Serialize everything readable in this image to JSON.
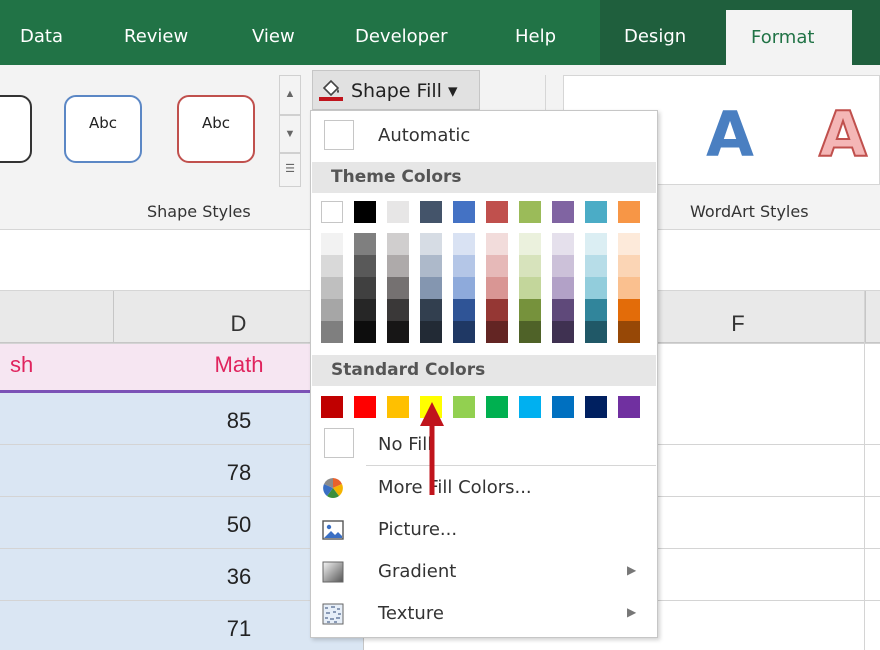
{
  "ribbon": {
    "tabs": [
      {
        "label": "Data"
      },
      {
        "label": "Review"
      },
      {
        "label": "View"
      },
      {
        "label": "Developer"
      },
      {
        "label": "Help"
      },
      {
        "label": "Design"
      },
      {
        "label": "Format"
      }
    ],
    "shape_styles": [
      {
        "label": "Abc"
      },
      {
        "label": "Abc"
      }
    ],
    "shape_styles_group_label": "Shape Styles",
    "wordart_group_label": "WordArt Styles",
    "wordart_samples": [
      "A",
      "A"
    ],
    "shape_fill_label": "Shape Fill"
  },
  "sheet": {
    "columns": [
      {
        "label": "D"
      },
      {
        "label": "F"
      }
    ],
    "header_row": {
      "left_label": "sh",
      "d_label": "Math"
    },
    "values": [
      "85",
      "78",
      "50",
      "36",
      "71"
    ]
  },
  "menu": {
    "automatic_label": "Automatic",
    "theme_colors_label": "Theme Colors",
    "standard_colors_label": "Standard Colors",
    "no_fill_label": "No Fill",
    "more_fill_colors_label": "More Fill Colors...",
    "picture_label": "Picture...",
    "gradient_label": "Gradient",
    "texture_label": "Texture",
    "theme_base_colors": [
      "#ffffff",
      "#000000",
      "#e7e6e6",
      "#44546a",
      "#4472c4",
      "#c0504d",
      "#9bbb59",
      "#8064a2",
      "#4bacc6",
      "#f79646"
    ],
    "theme_shade_columns": [
      [
        "#f2f2f2",
        "#d9d9d9",
        "#bfbfbf",
        "#a6a6a6",
        "#7f7f7f"
      ],
      [
        "#7f7f7f",
        "#595959",
        "#404040",
        "#262626",
        "#0d0d0d"
      ],
      [
        "#d0cece",
        "#aeaaaa",
        "#757171",
        "#3a3838",
        "#171616"
      ],
      [
        "#d6dce4",
        "#adb9ca",
        "#8496b0",
        "#323f4f",
        "#222a35"
      ],
      [
        "#d9e2f3",
        "#b4c6e7",
        "#8eaadb",
        "#2f5496",
        "#1f3864"
      ],
      [
        "#f2dcdb",
        "#e6b9b8",
        "#d99694",
        "#953734",
        "#632523"
      ],
      [
        "#ebf1dd",
        "#d7e3bc",
        "#c3d69b",
        "#76923c",
        "#4f6228"
      ],
      [
        "#e5e0ec",
        "#ccc1d9",
        "#b2a1c7",
        "#5f497a",
        "#3f3151"
      ],
      [
        "#dbeef3",
        "#b7dde8",
        "#92cddc",
        "#31859b",
        "#205867"
      ],
      [
        "#fdeada",
        "#fbd5b5",
        "#fac08f",
        "#e36c09",
        "#974806"
      ]
    ],
    "standard_colors": [
      "#c00000",
      "#ff0000",
      "#ffc000",
      "#ffff00",
      "#92d050",
      "#00b050",
      "#00b0f0",
      "#0070c0",
      "#002060",
      "#7030a0"
    ],
    "icons": {
      "bucket": "paint-bucket-icon",
      "more_colors": "color-wheel-icon",
      "picture": "picture-icon",
      "gradient": "gradient-icon",
      "texture": "texture-icon",
      "submenu": "chevron-right-icon"
    }
  },
  "annotation": {
    "arrow_color": "#c0141c"
  }
}
